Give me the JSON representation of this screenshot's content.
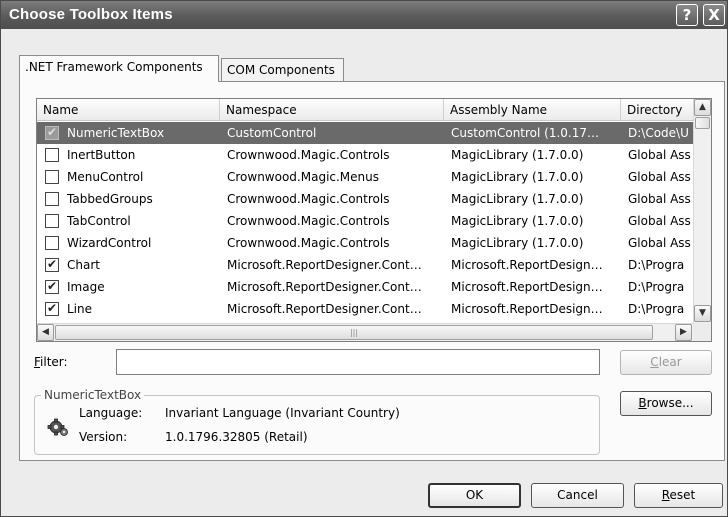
{
  "window": {
    "title": "Choose Toolbox Items",
    "help_glyph": "?",
    "close_glyph": "X"
  },
  "tabs": [
    {
      "label": ".NET Framework Components",
      "active": true
    },
    {
      "label": "COM Components",
      "active": false
    }
  ],
  "list": {
    "columns": [
      "Name",
      "Namespace",
      "Assembly Name",
      "Directory"
    ],
    "rows": [
      {
        "checked": true,
        "selected": true,
        "name": "NumericTextBox",
        "namespace": "CustomControl",
        "assembly": "CustomControl (1.0.17…",
        "directory": "D:\\Code\\U"
      },
      {
        "checked": false,
        "selected": false,
        "name": "InertButton",
        "namespace": "Crownwood.Magic.Controls",
        "assembly": "MagicLibrary (1.7.0.0)",
        "directory": "Global Ass"
      },
      {
        "checked": false,
        "selected": false,
        "name": "MenuControl",
        "namespace": "Crownwood.Magic.Menus",
        "assembly": "MagicLibrary (1.7.0.0)",
        "directory": "Global Ass"
      },
      {
        "checked": false,
        "selected": false,
        "name": "TabbedGroups",
        "namespace": "Crownwood.Magic.Controls",
        "assembly": "MagicLibrary (1.7.0.0)",
        "directory": "Global Ass"
      },
      {
        "checked": false,
        "selected": false,
        "name": "TabControl",
        "namespace": "Crownwood.Magic.Controls",
        "assembly": "MagicLibrary (1.7.0.0)",
        "directory": "Global Ass"
      },
      {
        "checked": false,
        "selected": false,
        "name": "WizardControl",
        "namespace": "Crownwood.Magic.Controls",
        "assembly": "MagicLibrary (1.7.0.0)",
        "directory": "Global Ass"
      },
      {
        "checked": true,
        "selected": false,
        "name": "Chart",
        "namespace": "Microsoft.ReportDesigner.Cont…",
        "assembly": "Microsoft.ReportDesign…",
        "directory": "D:\\Progra"
      },
      {
        "checked": true,
        "selected": false,
        "name": "Image",
        "namespace": "Microsoft.ReportDesigner.Cont…",
        "assembly": "Microsoft.ReportDesign…",
        "directory": "D:\\Progra"
      },
      {
        "checked": true,
        "selected": false,
        "name": "Line",
        "namespace": "Microsoft.ReportDesigner.Cont…",
        "assembly": "Microsoft.ReportDesign…",
        "directory": "D:\\Progra"
      }
    ]
  },
  "filter": {
    "label_accel": "F",
    "label_rest": "ilter:",
    "value": ""
  },
  "buttons": {
    "clear_accel": "C",
    "clear_rest": "lear",
    "browse_accel": "B",
    "browse_rest": "rowse...",
    "ok": "OK",
    "cancel": "Cancel",
    "reset_accel": "R",
    "reset_rest": "eset"
  },
  "details": {
    "group_title": "NumericTextBox",
    "icon": "gear-icon",
    "language_label": "Language:",
    "language_value": "Invariant Language (Invariant Country)",
    "version_label": "Version:",
    "version_value": "1.0.1796.32805 (Retail)"
  },
  "colors": {
    "selection": "#6a6a6a",
    "titlebar": "#5a5a5a"
  }
}
